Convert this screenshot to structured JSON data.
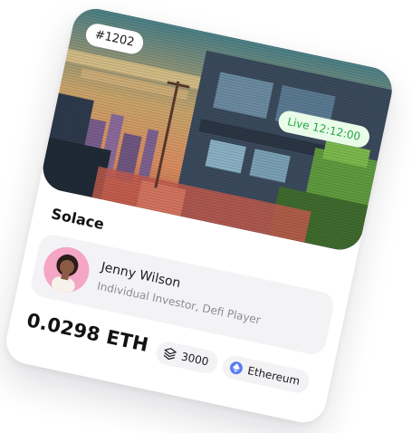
{
  "card": {
    "token_id": "#1202",
    "live_label": "Live 12:12:00",
    "title": "Solace",
    "owner": {
      "name": "Jenny Wilson",
      "role": "Individual Investor, Defi Player"
    },
    "price": "0.0298 ETH",
    "edition_count": "3000",
    "network": "Ethereum"
  },
  "icons": {
    "edition": "stack-layers-icon",
    "network": "ethereum-icon",
    "avatar": "user-avatar"
  },
  "colors": {
    "live_text": "#23a845",
    "live_bg": "#e9fbe9",
    "ethereum": "#5b7cf0",
    "chip_bg": "#f3f3f5"
  }
}
